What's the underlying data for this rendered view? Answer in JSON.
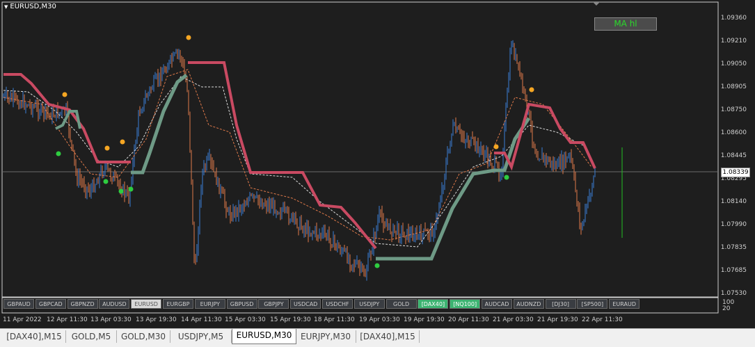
{
  "chart": {
    "symbol_title": "EURUSD,M30",
    "ma_button": "MA hl",
    "current_price": "1.08339",
    "price_labels": [
      "1.09360",
      "1.09210",
      "1.09050",
      "1.08905",
      "1.08750",
      "1.08600",
      "1.08445",
      "1.08295",
      "1.08140",
      "1.07990",
      "1.07835",
      "1.07685",
      "1.07530"
    ],
    "time_labels": [
      "11 Apr 2022",
      "12 Apr 11:30",
      "13 Apr 03:30",
      "13 Apr 19:30",
      "14 Apr 11:30",
      "15 Apr 03:30",
      "15 Apr 19:30",
      "18 Apr 11:30",
      "19 Apr 03:30",
      "19 Apr 19:30",
      "20 Apr 11:30",
      "21 Apr 03:30",
      "21 Apr 19:30",
      "22 Apr 11:30"
    ],
    "subwindow_labels": [
      "100",
      "20"
    ],
    "colors": {
      "bull": "#3a7fd5",
      "bear": "#e07a4a",
      "ma_down": "#c94a62",
      "ma_up": "#6e9a86",
      "dot_orange": "#f5a623",
      "dot_green": "#2ecc40",
      "bg": "#1e1e1e"
    }
  },
  "symbol_buttons": [
    {
      "label": "GBPAUD",
      "state": "normal"
    },
    {
      "label": "GBPCAD",
      "state": "normal"
    },
    {
      "label": "GBPNZD",
      "state": "normal"
    },
    {
      "label": "AUDUSD",
      "state": "normal"
    },
    {
      "label": "EURUSD",
      "state": "active"
    },
    {
      "label": "EURGBP",
      "state": "normal"
    },
    {
      "label": "EURJPY",
      "state": "normal"
    },
    {
      "label": "GBPUSD",
      "state": "normal"
    },
    {
      "label": "GBPJPY",
      "state": "normal"
    },
    {
      "label": "USDCAD",
      "state": "normal"
    },
    {
      "label": "USDCHF",
      "state": "normal"
    },
    {
      "label": "USDJPY",
      "state": "normal"
    },
    {
      "label": "GOLD",
      "state": "normal"
    },
    {
      "label": "[DAX40]",
      "state": "green"
    },
    {
      "label": "[NQ100]",
      "state": "green"
    },
    {
      "label": "AUDCAD",
      "state": "normal"
    },
    {
      "label": "AUDNZD",
      "state": "normal"
    },
    {
      "label": "[DJ30]",
      "state": "normal"
    },
    {
      "label": "[SP500]",
      "state": "normal"
    },
    {
      "label": "EURAUD",
      "state": "normal"
    }
  ],
  "tabs": [
    {
      "label": "[DAX40],M15",
      "active": false
    },
    {
      "label": "GOLD,M5",
      "active": false
    },
    {
      "label": "GOLD,M30",
      "active": false
    },
    {
      "label": "USDJPY,M5",
      "active": false
    },
    {
      "label": "EURUSD,M30",
      "active": true
    },
    {
      "label": "EURJPY,M30",
      "active": false
    },
    {
      "label": "[DAX40],M15",
      "active": false
    }
  ]
}
